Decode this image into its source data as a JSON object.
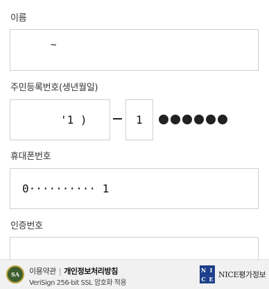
{
  "form": {
    "name_label": "이름",
    "name_value": "~",
    "birth_label": "주민등록번호(생년월일)",
    "birth_value": "'1 )",
    "gender_value": "1",
    "masked_dots": 6,
    "phone_label": "휴대폰번호",
    "phone_value": "0·········· 1",
    "code_label": "인증번호",
    "code_value": ""
  },
  "footer": {
    "badge": "SA",
    "terms": "이용약관",
    "privacy": "개인정보처리방침",
    "security": "VeriSign 256-bit SSL 암호화 적용",
    "nice_letters": [
      "N",
      "I",
      "C",
      "E"
    ],
    "nice_brand": "NICE평가정보"
  },
  "colors": {
    "nice_blue": "#1e3f8a",
    "sa_green": "#3c5d2e"
  }
}
